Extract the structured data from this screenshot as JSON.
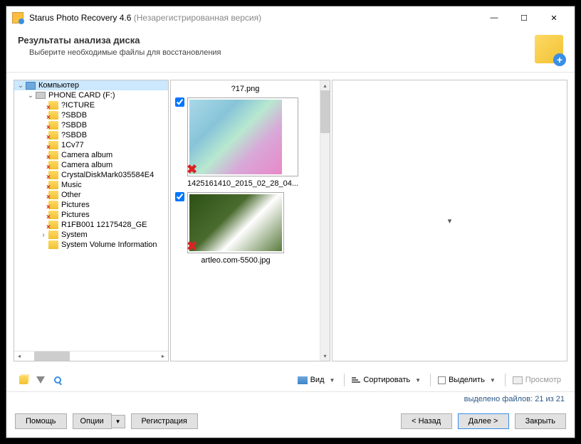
{
  "title": {
    "app": "Starus Photo Recovery 4.6",
    "unreg": "(Незарегистрированная версия)"
  },
  "header": {
    "h": "Результаты анализа диска",
    "sub": "Выберите необходимые файлы для восстановления"
  },
  "tree": {
    "root": "Компьютер",
    "drive": "PHONE CARD (F:)",
    "items": [
      "?ICTURE",
      "?SBDB",
      "?SBDB",
      "?SBDB",
      "1Cv77",
      "Camera album",
      "Camera album",
      "CrystalDiskMark035584E4",
      "Music",
      "Other",
      "Pictures",
      "Pictures",
      "R1FB001 12175428_GE",
      "System",
      "System Volume Information"
    ]
  },
  "thumbs": {
    "top_label": "?17.png",
    "file1": "1425161410_2015_02_28_04...",
    "file2": "artleo.com-5500.jpg"
  },
  "preview_arrow": "▾",
  "toolbar": {
    "view": "Вид",
    "sort": "Сортировать",
    "select": "Выделить",
    "preview": "Просмотр"
  },
  "status": "выделено файлов: 21 из 21",
  "footer": {
    "help": "Помощь",
    "options": "Опции",
    "register": "Регистрация",
    "back": "< Назад",
    "next": "Далее >",
    "close": "Закрыть"
  }
}
